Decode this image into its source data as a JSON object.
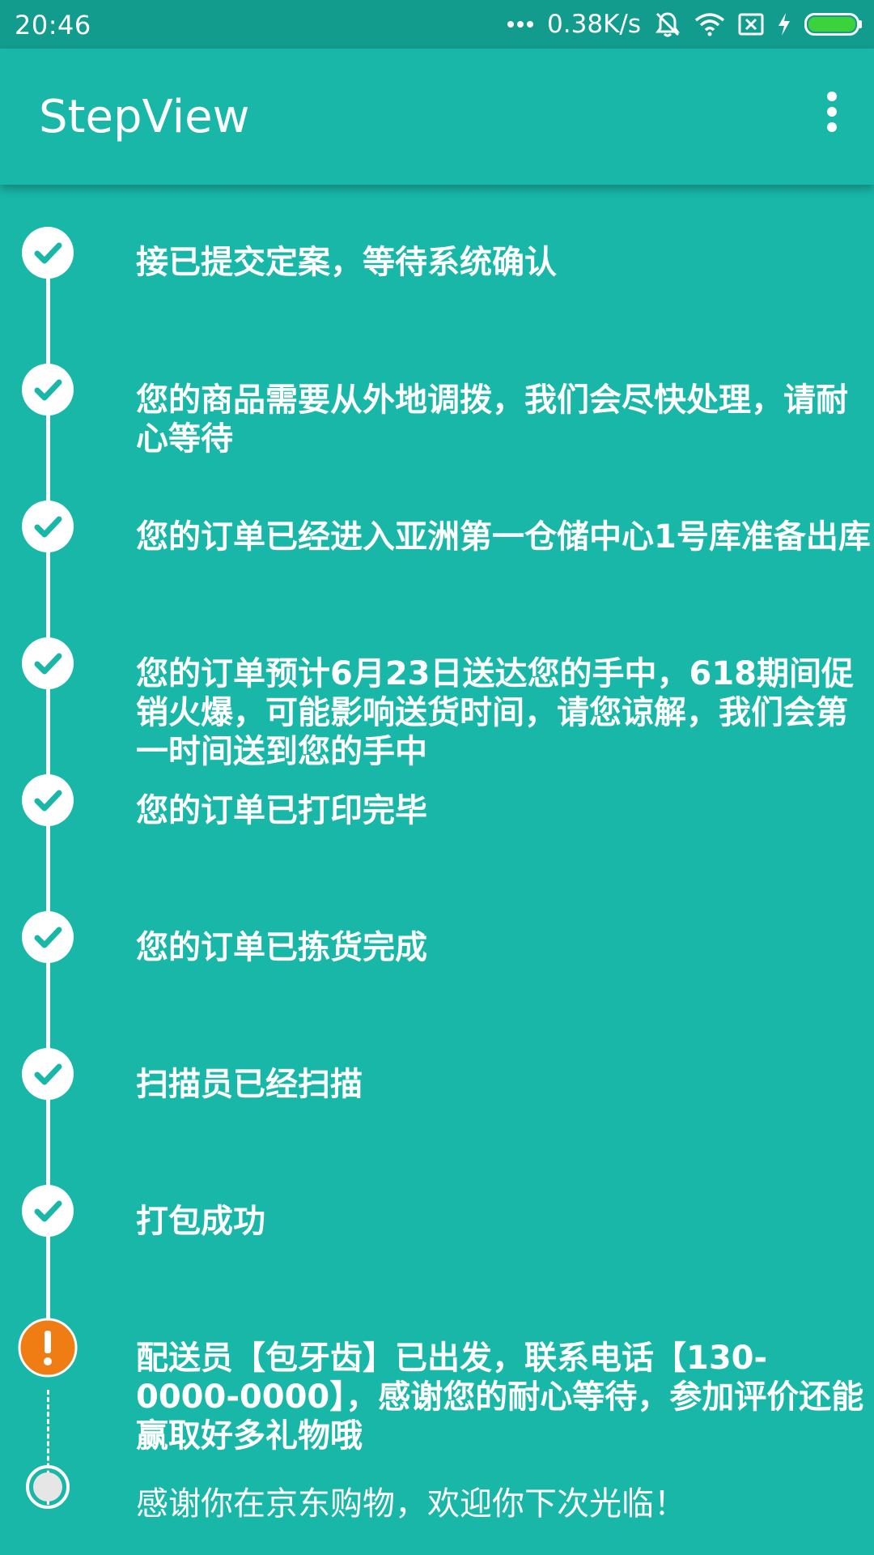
{
  "status_bar": {
    "time": "20:46",
    "net_speed": "0.38K/s",
    "icons": [
      "more-dots-icon",
      "silent-bell-icon",
      "wifi-icon",
      "no-sim-icon",
      "charging-bolt-icon",
      "battery-icon"
    ],
    "battery_color": "#3CD23C"
  },
  "app_bar": {
    "title": "StepView",
    "menu_icon": "overflow-menu-icon"
  },
  "colors": {
    "background": "#19B7A7",
    "status_bar": "#129C8E",
    "line": "#FFFFFF",
    "attention": "#F07D14"
  },
  "steps": [
    {
      "state": "complete",
      "icon": "check-icon",
      "text": "接已提交定案，等待系统确认"
    },
    {
      "state": "complete",
      "icon": "check-icon",
      "text": "您的商品需要从外地调拨，我们会尽快处理，请耐心等待"
    },
    {
      "state": "complete",
      "icon": "check-icon",
      "text": "您的订单已经进入亚洲第一仓储中心1号库准备出库"
    },
    {
      "state": "complete",
      "icon": "check-icon",
      "text": "您的订单预计6月23日送达您的手中，618期间促销火爆，可能影响送货时间，请您谅解，我们会第一时间送到您的手中"
    },
    {
      "state": "complete",
      "icon": "check-icon",
      "text": "您的订单已打印完毕"
    },
    {
      "state": "complete",
      "icon": "check-icon",
      "text": "您的订单已拣货完成"
    },
    {
      "state": "complete",
      "icon": "check-icon",
      "text": "扫描员已经扫描"
    },
    {
      "state": "complete",
      "icon": "check-icon",
      "text": "打包成功"
    },
    {
      "state": "current",
      "icon": "attention-icon",
      "text": "配送员【包牙齿】已出发，联系电话【130-0000-0000】，感谢您的耐心等待，参加评价还能赢取好多礼物哦"
    },
    {
      "state": "pending",
      "icon": "pending-circle-icon",
      "text": "感谢你在京东购物，欢迎你下次光临！"
    }
  ]
}
